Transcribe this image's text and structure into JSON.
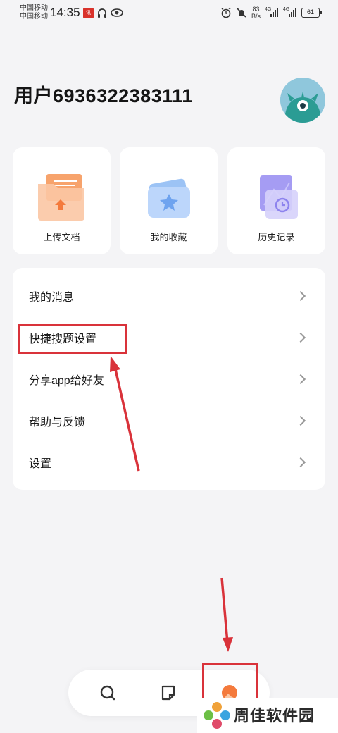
{
  "status_bar": {
    "carrier1": "中国移动",
    "carrier2": "中国移动",
    "time": "14:35",
    "net_speed_value": "83",
    "net_speed_unit": "B/s",
    "signal1": "4G",
    "signal2": "4G",
    "battery": "61"
  },
  "profile": {
    "username": "用户6936322383111"
  },
  "quick_actions": [
    {
      "label": "上传文档",
      "icon": "upload-folder-icon"
    },
    {
      "label": "我的收藏",
      "icon": "favorites-icon"
    },
    {
      "label": "历史记录",
      "icon": "history-icon"
    }
  ],
  "menu": [
    {
      "label": "我的消息"
    },
    {
      "label": "快捷搜题设置"
    },
    {
      "label": "分享app给好友"
    },
    {
      "label": "帮助与反馈"
    },
    {
      "label": "设置"
    }
  ],
  "bottom_nav": [
    {
      "icon": "search-icon",
      "active": false
    },
    {
      "icon": "notes-icon",
      "active": false
    },
    {
      "icon": "profile-icon",
      "active": true
    }
  ],
  "watermark": {
    "text": "周佳软件园"
  },
  "colors": {
    "accent_red": "#d9323a",
    "orange": "#f47a3c",
    "background": "#f4f4f6"
  }
}
